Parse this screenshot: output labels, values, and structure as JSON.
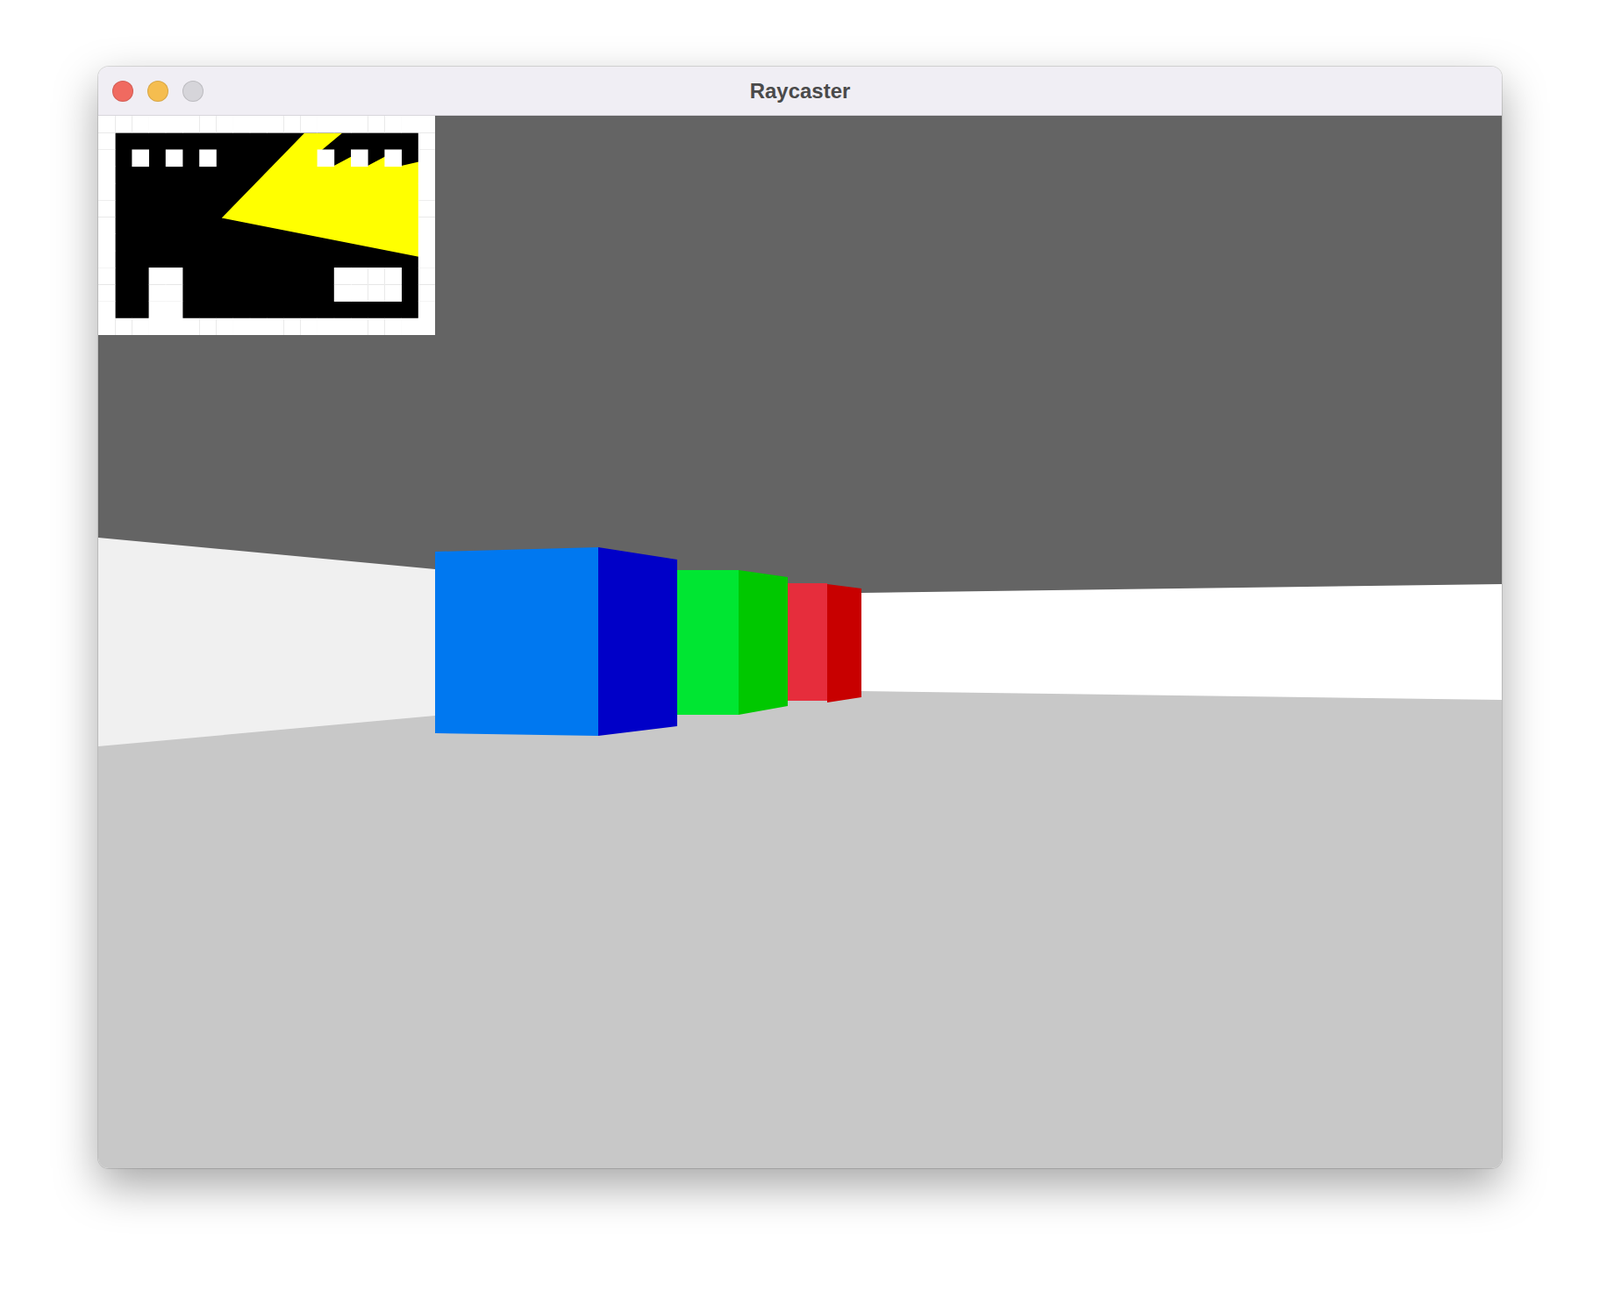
{
  "window": {
    "title": "Raycaster",
    "controls": [
      {
        "name": "close",
        "color": "#f06a60",
        "disabled": false
      },
      {
        "name": "minimize",
        "color": "#f5bd4f",
        "disabled": false
      },
      {
        "name": "zoom",
        "color": "#d6d5da",
        "disabled": true
      }
    ]
  },
  "minimap": {
    "rows": [
      "####################",
      "#..................#",
      "#.#.#.#......#.#.#.#",
      "#..................#",
      "#..................#",
      "#..................#",
      "#..................#",
      "#..................#",
      "#..................#",
      "#..##.........####.#",
      "#..##.........####.#",
      "#..##..............#",
      "####################"
    ],
    "view_cone": [
      [
        7.33,
        6.06
      ],
      [
        12.24,
        1.03
      ],
      [
        14.48,
        1.03
      ],
      [
        13.03,
        2.24
      ],
      [
        14.0,
        2.97
      ],
      [
        15.03,
        2.42
      ],
      [
        16.0,
        2.97
      ],
      [
        17.03,
        2.42
      ],
      [
        18.0,
        2.97
      ],
      [
        19.03,
        2.73
      ],
      [
        19.03,
        8.36
      ]
    ]
  },
  "scene": {
    "walls": [
      {
        "color": "#f0f0f0",
        "x": [
          0,
          384
        ],
        "top": [
          481,
          517
        ],
        "bottom": [
          719,
          684
        ]
      },
      {
        "color": "#0078f0",
        "x": [
          384,
          570
        ],
        "top": [
          497,
          492
        ],
        "bottom": [
          704,
          707
        ]
      },
      {
        "color": "#0000c8",
        "x": [
          570,
          660
        ],
        "top": [
          492,
          506
        ],
        "bottom": [
          707,
          696
        ]
      },
      {
        "color": "#00e632",
        "x": [
          660,
          730
        ],
        "top": [
          518,
          518
        ],
        "bottom": [
          683,
          683
        ]
      },
      {
        "color": "#00c800",
        "x": [
          730,
          786
        ],
        "top": [
          518,
          526
        ],
        "bottom": [
          683,
          673
        ]
      },
      {
        "color": "#e62d3c",
        "x": [
          786,
          831
        ],
        "top": [
          533,
          533
        ],
        "bottom": [
          667,
          667
        ]
      },
      {
        "color": "#c80000",
        "x": [
          831,
          870
        ],
        "top": [
          534,
          539
        ],
        "bottom": [
          669,
          663
        ]
      },
      {
        "color": "#ffffff",
        "x": [
          870,
          1600
        ],
        "top": [
          544,
          534
        ],
        "bottom": [
          656,
          666
        ]
      }
    ]
  }
}
